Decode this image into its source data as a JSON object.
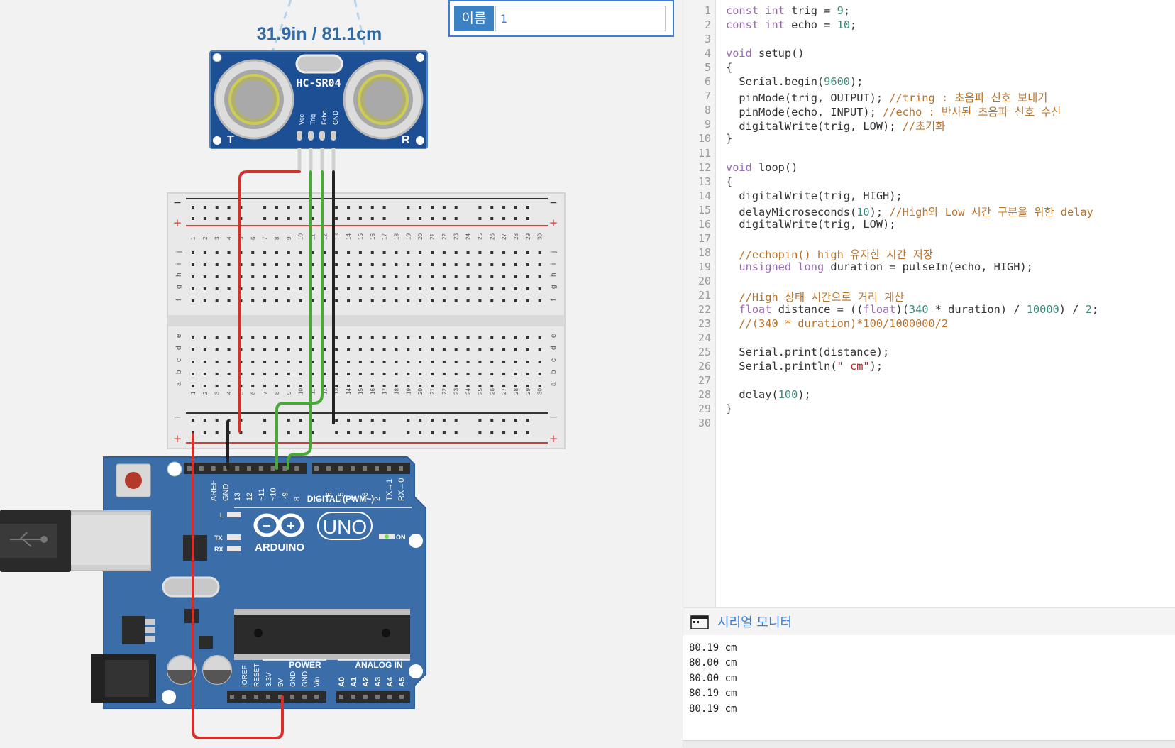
{
  "sensor": {
    "distance_label": "31.9in / 81.1cm",
    "model": "HC-SR04",
    "pins": [
      "Vcc",
      "Trig",
      "Echo",
      "GND"
    ],
    "t_mark": "T",
    "r_mark": "R"
  },
  "name_box": {
    "label": "이름",
    "value": "1"
  },
  "arduino": {
    "brand": "ARDUINO",
    "model": "UNO",
    "digital_label": "DIGITAL (PWM~)",
    "digital_pins": [
      "AREF",
      "GND",
      "13",
      "12",
      "~11",
      "~10",
      "~9",
      "8",
      "7",
      "~6",
      "~5",
      "4",
      "~3",
      "2",
      "TX→1",
      "RX←0"
    ],
    "power_label": "POWER",
    "analog_label": "ANALOG IN",
    "power_pins": [
      "IOREF",
      "RESET",
      "3.3V",
      "5V",
      "GND",
      "GND",
      "Vin"
    ],
    "analog_pins": [
      "A0",
      "A1",
      "A2",
      "A3",
      "A4",
      "A5"
    ],
    "led_l": "L",
    "led_tx": "TX",
    "led_rx": "RX",
    "led_on": "ON"
  },
  "breadboard": {
    "minus": "−",
    "plus": "+",
    "top_rows": [
      "j",
      "i",
      "h",
      "g",
      "f"
    ],
    "bottom_rows": [
      "e",
      "d",
      "c",
      "b",
      "a"
    ],
    "columns": 30
  },
  "editor": {
    "lines": [
      "const int trig = 9;",
      "const int echo = 10;",
      "",
      "void setup()",
      "{",
      "  Serial.begin(9600);",
      "  pinMode(trig, OUTPUT); //tring : 초음파 신호 보내기",
      "  pinMode(echo, INPUT); //echo : 반사된 초음파 신호 수신",
      "  digitalWrite(trig, LOW); //초기화",
      "}",
      "",
      "void loop()",
      "{",
      "  digitalWrite(trig, HIGH);",
      "  delayMicroseconds(10); //High와 Low 시간 구분을 위한 delay",
      "  digitalWrite(trig, LOW);",
      "",
      "  //echopin() high 유지한 시간 저장",
      "  unsigned long duration = pulseIn(echo, HIGH);",
      "",
      "  //High 상태 시간으로 거리 계산",
      "  float distance = ((float)(340 * duration) / 10000) / 2;",
      "  //(340 * duration)*100/1000000/2",
      "",
      "  Serial.print(distance);",
      "  Serial.println(\" cm\");",
      "",
      "  delay(100);",
      "}",
      ""
    ]
  },
  "serial_monitor": {
    "title": "시리얼 모니터",
    "lines": [
      "80.19 cm",
      "80.19 cm",
      "80.00 cm",
      "80.00 cm",
      "80.19 cm",
      "80.19 cm"
    ]
  },
  "colors": {
    "arduino_blue": "#3b6ea8",
    "sensor_blue": "#1d4f94",
    "wire_red": "#d42f2a",
    "wire_green": "#4aa83a",
    "wire_black": "#222222",
    "accent": "#3b7dd8"
  }
}
